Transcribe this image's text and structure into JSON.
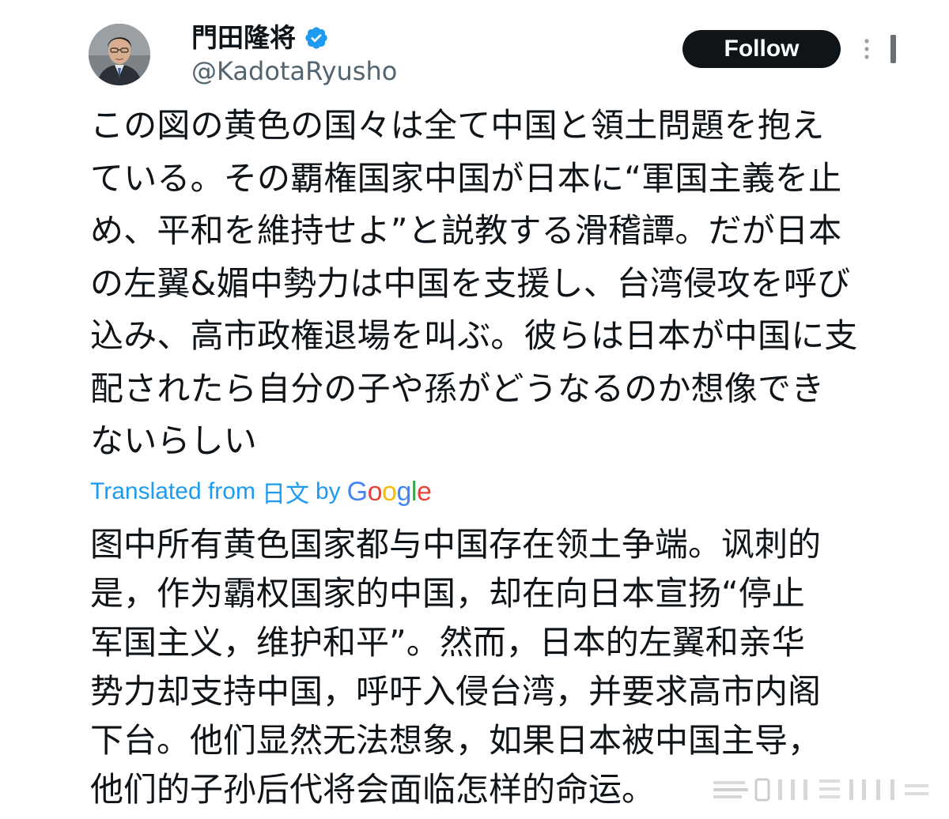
{
  "author": {
    "display_name": "門田隆将",
    "handle": "@KadotaRyusho",
    "verified": true,
    "avatar_icon": "avatar-photo"
  },
  "actions": {
    "follow_label": "Follow",
    "more_icon": "more-vertical-icon"
  },
  "tweet": {
    "lines": [
      "この図の黄色の国々は全て中国と領土問題を抱え",
      "ている。その覇権国家中国が日本に“軍国主義を止",
      "め、平和を維持せよ”と説教する滑稽譚。だが日本",
      "の左翼&媚中勢力は中国を支援し、台湾侵攻を呼び",
      "込み、高市政権退場を叫ぶ。彼らは日本が中国に支",
      "配されたら自分の子や孫がどうなるのか想像でき",
      "ないらしい"
    ]
  },
  "translation": {
    "prefix": "Translated from",
    "source_language": "日文",
    "by": "by",
    "provider": "Google",
    "lines": [
      "图中所有黄色国家都与中国存在领土争端。讽刺的",
      "是，作为霸权国家的中国，却在向日本宣扬“停止",
      "军国主义，维护和平”。然而，日本的左翼和亲华",
      "势力却支持中国，呼吁入侵台湾，并要求高市内阁",
      "下台。他们显然无法想象，如果日本被中国主导，",
      "他们的子孙后代将会面临怎样的命运。"
    ]
  },
  "colors": {
    "text": "#0f1419",
    "secondary_text": "#536471",
    "link": "#1d9bf0",
    "verified": "#1d9bf0",
    "button_bg": "#0f1419",
    "google_blue": "#4285f4",
    "google_red": "#ea4335",
    "google_yellow": "#fbbc05",
    "google_green": "#34a853"
  }
}
